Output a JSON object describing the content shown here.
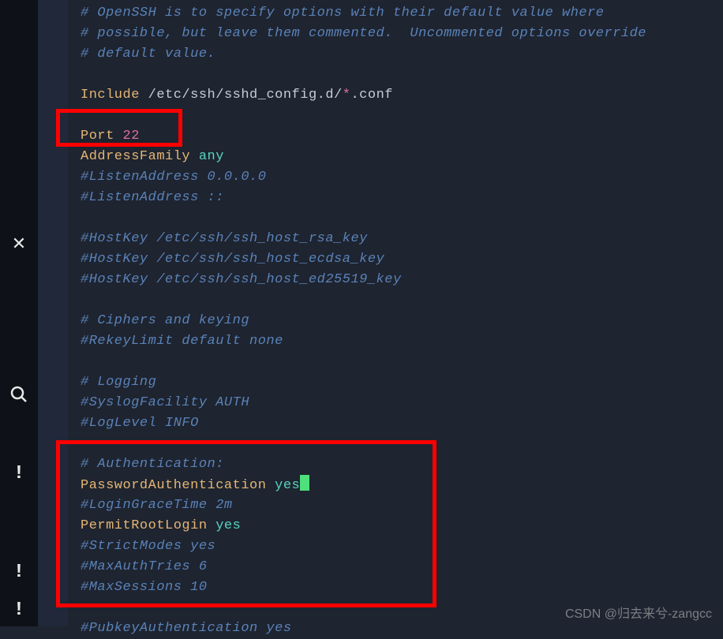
{
  "sidebar": {
    "close_icon": "✕",
    "search_icon": "search",
    "exclaim1": "!",
    "exclaim2": "!",
    "exclaim3": "!"
  },
  "code": {
    "l1": "# OpenSSH is to specify options with their default value where",
    "l2": "# possible, but leave them commented.  Uncommented options override",
    "l3": "# default value.",
    "l4": "",
    "l5_kw": "Include",
    "l5_path": " /etc/ssh/sshd_config.d/",
    "l5_star": "*",
    "l5_ext": ".conf",
    "l6": "",
    "l7_kw": "Port",
    "l7_sp": " ",
    "l7_val": "22",
    "l8_kw": "AddressFamily",
    "l8_sp": " ",
    "l8_val": "any",
    "l9": "#ListenAddress 0.0.0.0",
    "l10": "#ListenAddress ::",
    "l11": "",
    "l12": "#HostKey /etc/ssh/ssh_host_rsa_key",
    "l13": "#HostKey /etc/ssh/ssh_host_ecdsa_key",
    "l14": "#HostKey /etc/ssh/ssh_host_ed25519_key",
    "l15": "",
    "l16": "# Ciphers and keying",
    "l17": "#RekeyLimit default none",
    "l18": "",
    "l19": "# Logging",
    "l20": "#SyslogFacility AUTH",
    "l21": "#LogLevel INFO",
    "l22": "",
    "l23": "# Authentication:",
    "l24_kw": "PasswordAuthentication",
    "l24_sp": " ",
    "l24_val": "yes",
    "l25": "#LoginGraceTime 2m",
    "l26_kw": "PermitRootLogin",
    "l26_sp": " ",
    "l26_val": "yes",
    "l27": "#StrictModes yes",
    "l28": "#MaxAuthTries 6",
    "l29": "#MaxSessions 10",
    "l30": "",
    "l31": "#PubkeyAuthentication yes"
  },
  "watermark": "CSDN @归去来兮-zangcc"
}
